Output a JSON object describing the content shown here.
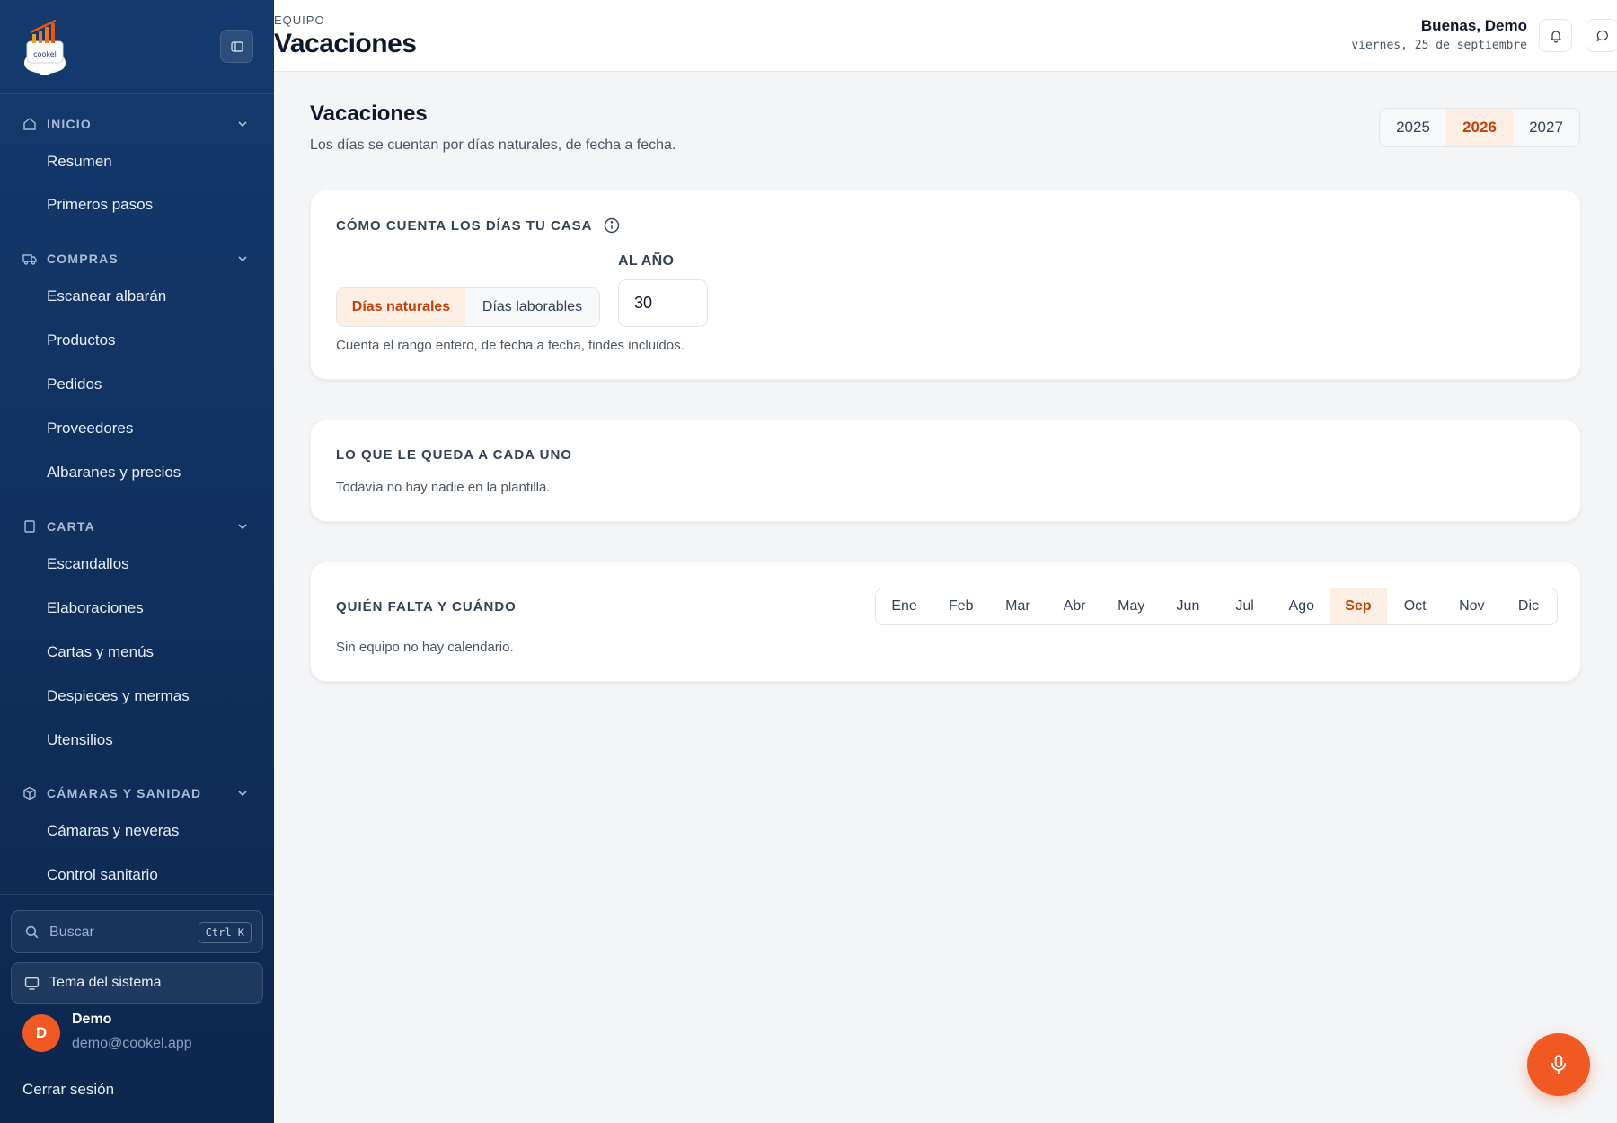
{
  "sidebar": {
    "logo_text": "cookel",
    "sections": [
      {
        "label": "INICIO",
        "items": [
          "Resumen",
          "Primeros pasos"
        ]
      },
      {
        "label": "COMPRAS",
        "items": [
          "Escanear albarán",
          "Productos",
          "Pedidos",
          "Proveedores",
          "Albaranes y precios"
        ]
      },
      {
        "label": "CARTA",
        "items": [
          "Escandallos",
          "Elaboraciones",
          "Cartas y menús",
          "Despieces y mermas",
          "Utensilios"
        ]
      },
      {
        "label": "CÁMARAS Y SANIDAD",
        "items": [
          "Cámaras y neveras",
          "Control sanitario"
        ]
      }
    ],
    "search": {
      "placeholder": "Buscar",
      "shortcut": "Ctrl K"
    },
    "theme_label": "Tema del sistema",
    "user": {
      "initial": "D",
      "name": "Demo",
      "email": "demo@cookel.app"
    },
    "logout_label": "Cerrar sesión"
  },
  "header": {
    "eyebrow": "EQUIPO",
    "title": "Vacaciones",
    "greeting": "Buenas, Demo",
    "date": "viernes, 25 de septiembre"
  },
  "main": {
    "title": "Vacaciones",
    "subtitle": "Los días se cuentan por días naturales, de fecha a fecha.",
    "years": [
      "2025",
      "2026",
      "2027"
    ],
    "selected_year": "2026",
    "count_card": {
      "title": "CÓMO CUENTA LOS DÍAS TU CASA",
      "modes": [
        "Días naturales",
        "Días laborables"
      ],
      "selected_mode": "Días naturales",
      "per_year_label": "AL AÑO",
      "per_year_value": "30",
      "hint": "Cuenta el rango entero, de fecha a fecha, findes incluidos."
    },
    "remaining_card": {
      "title": "LO QUE LE QUEDA A CADA UNO",
      "empty": "Todavía no hay nadie en la plantilla."
    },
    "calendar_card": {
      "title": "QUIÉN FALTA Y CUÁNDO",
      "months": [
        "Ene",
        "Feb",
        "Mar",
        "Abr",
        "May",
        "Jun",
        "Jul",
        "Ago",
        "Sep",
        "Oct",
        "Nov",
        "Dic"
      ],
      "selected_month": "Sep",
      "empty": "Sin equipo no hay calendario."
    }
  },
  "colors": {
    "sidebar_bg": "#0f2f5c",
    "accent": "#f05a22",
    "accent_soft": "#fdeee4",
    "accent_text": "#c2410c"
  }
}
